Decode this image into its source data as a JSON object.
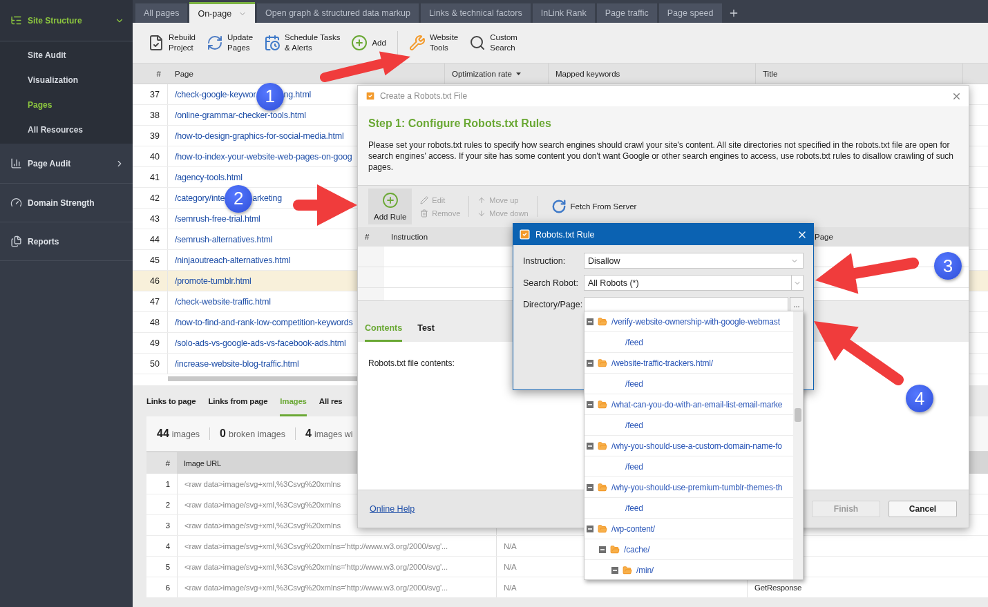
{
  "sidebar": {
    "items": [
      {
        "label": "Site Structure",
        "expanded": true,
        "selected": true,
        "children": [
          {
            "label": "Site Audit",
            "selected": false
          },
          {
            "label": "Visualization",
            "selected": false
          },
          {
            "label": "Pages",
            "selected": true
          },
          {
            "label": "All Resources",
            "selected": false
          }
        ]
      },
      {
        "label": "Page Audit",
        "expanded": false,
        "selected": false
      },
      {
        "label": "Domain Strength",
        "selected": false
      },
      {
        "label": "Reports",
        "selected": false
      }
    ]
  },
  "tabs": [
    {
      "label": "All pages",
      "selected": false,
      "menu": false
    },
    {
      "label": "On-page",
      "selected": true,
      "menu": true
    },
    {
      "label": "Open graph & structured data markup",
      "selected": false,
      "menu": false
    },
    {
      "label": "Links & technical factors",
      "selected": false,
      "menu": false
    },
    {
      "label": "InLink Rank",
      "selected": false,
      "menu": false
    },
    {
      "label": "Page traffic",
      "selected": false,
      "menu": false
    },
    {
      "label": "Page speed",
      "selected": false,
      "menu": false
    }
  ],
  "toolbar": [
    {
      "lines": [
        "Rebuild",
        "Project"
      ],
      "separator_before": false
    },
    {
      "lines": [
        "Update",
        "Pages"
      ],
      "separator_before": false
    },
    {
      "lines": [
        "Schedule Tasks",
        "& Alerts"
      ],
      "separator_before": false
    },
    {
      "lines": [
        "Add"
      ],
      "separator_before": false
    },
    {
      "lines": [
        "Website",
        "Tools"
      ],
      "separator_before": true
    },
    {
      "lines": [
        "Custom",
        "Search"
      ],
      "separator_before": false
    }
  ],
  "table": {
    "columns": [
      {
        "label": "#",
        "menu": false
      },
      {
        "label": "Page",
        "menu": false
      },
      {
        "label": "Optimization rate",
        "menu": true
      },
      {
        "label": "Mapped keywords",
        "menu": false
      },
      {
        "label": "Title",
        "menu": false
      }
    ],
    "rows": [
      {
        "number": "37",
        "page_parts": [
          "/check-google-keywor",
          "ng.html"
        ],
        "callout": "1",
        "selected": false
      },
      {
        "number": "38",
        "page_parts": [
          "/online-grammar-checker-tools.html"
        ],
        "selected": false
      },
      {
        "number": "39",
        "page_parts": [
          "/how-to-design-graphics-for-social-media.html"
        ],
        "selected": false
      },
      {
        "number": "40",
        "page_parts": [
          "/how-to-index-your-website-web-pages-on-goog"
        ],
        "selected": false
      },
      {
        "number": "41",
        "page_parts": [
          "/agency-tools.html"
        ],
        "selected": false
      },
      {
        "number": "42",
        "page_parts": [
          "/category/inte",
          "arketing"
        ],
        "callout": "2",
        "selected": false
      },
      {
        "number": "43",
        "page_parts": [
          "/semrush-free-trial.html"
        ],
        "selected": false
      },
      {
        "number": "44",
        "page_parts": [
          "/semrush-alternatives.html"
        ],
        "selected": false
      },
      {
        "number": "45",
        "page_parts": [
          "/ninjaoutreach-alternatives.html"
        ],
        "selected": false
      },
      {
        "number": "46",
        "page_parts": [
          "/promote-tumblr.html"
        ],
        "selected": true
      },
      {
        "number": "47",
        "page_parts": [
          "/check-website-traffic.html"
        ],
        "selected": false
      },
      {
        "number": "48",
        "page_parts": [
          "/how-to-find-and-rank-low-competition-keywords"
        ],
        "selected": false
      },
      {
        "number": "49",
        "page_parts": [
          "/solo-ads-vs-google-ads-vs-facebook-ads.html"
        ],
        "selected": false
      },
      {
        "number": "50",
        "page_parts": [
          "/increase-website-blog-traffic.html"
        ],
        "selected": false
      }
    ]
  },
  "bottom": {
    "tabs": [
      {
        "label": "Links to page",
        "selected": false
      },
      {
        "label": "Links from page",
        "selected": false
      },
      {
        "label": "Images",
        "selected": true
      },
      {
        "label": "All res",
        "selected": false
      }
    ],
    "stats": [
      {
        "count": "44",
        "label": "images"
      },
      {
        "count": "0",
        "label": "broken images"
      },
      {
        "count": "4",
        "label": "images wi"
      }
    ],
    "image_table": {
      "columns": [
        "#",
        "Image URL"
      ],
      "rows": [
        {
          "number": "1",
          "url": "<raw data>image/svg+xml,%3Csvg%20xmlns"
        },
        {
          "number": "2",
          "url": "<raw data>image/svg+xml,%3Csvg%20xmlns"
        },
        {
          "number": "3",
          "url": "<raw data>image/svg+xml,%3Csvg%20xmlns"
        },
        {
          "number": "4",
          "url": "<raw data>image/svg+xml,%3Csvg%20xmlns='http://www.w3.org/2000/svg'...",
          "column_3": "N/A"
        },
        {
          "number": "5",
          "url": "<raw data>image/svg+xml,%3Csvg%20xmlns='http://www.w3.org/2000/svg'...",
          "column_3": "N/A"
        },
        {
          "number": "6",
          "url": "<raw data>image/svg+xml,%3Csvg%20xmlns='http://www.w3.org/2000/svg'...",
          "column_3": "N/A",
          "column_4": "GetResponse"
        }
      ]
    }
  },
  "robots_dialog": {
    "title": "Create a Robots.txt File",
    "heading": "Step 1: Configure Robots.txt Rules",
    "description": "Please set your robots.txt rules to specify how search engines should crawl your site's content. All site directories not specified in the robots.txt file are open for search engines' access. If your site has some content you don't want Google or other search engines to access, use robots.txt rules to disallow crawling of such pages.",
    "toolbar": [
      {
        "label": "Add Rule",
        "kind": "large",
        "disabled": false,
        "highlighted": true
      },
      {
        "label": "Edit",
        "kind": "small",
        "disabled": true,
        "highlighted": false
      },
      {
        "label": "Remove",
        "kind": "small",
        "disabled": true,
        "highlighted": false
      },
      {
        "label": "Move up",
        "kind": "small",
        "disabled": true,
        "highlighted": false
      },
      {
        "label": "Move down",
        "kind": "small",
        "disabled": true,
        "highlighted": false
      },
      {
        "label": "Fetch From Server",
        "kind": "large",
        "disabled": false,
        "highlighted": false
      }
    ],
    "rule_columns": [
      "#",
      "Instruction",
      "Page"
    ],
    "tabs": [
      {
        "label": "Contents",
        "selected": true
      },
      {
        "label": "Test",
        "selected": false
      }
    ],
    "contents_label": "Robots.txt file contents:",
    "help_link": "Online Help",
    "buttons": [
      {
        "label": "Finish",
        "disabled": true
      },
      {
        "label": "Cancel",
        "disabled": false
      }
    ]
  },
  "rule_dialog": {
    "title": "Robots.txt Rule",
    "fields": [
      {
        "label": "Instruction:",
        "kind": "select",
        "value": "Disallow"
      },
      {
        "label": "Search Robot:",
        "kind": "combo",
        "value": "All Robots (*)"
      },
      {
        "label": "Directory/Page:",
        "kind": "browse",
        "browse_label": "..."
      }
    ],
    "tree": [
      {
        "label": "/verify-website-ownership-with-google-webmast",
        "expanded": true,
        "children": [
          {
            "label": "/feed"
          }
        ]
      },
      {
        "label": "/website-traffic-trackers.html/",
        "expanded": true,
        "children": [
          {
            "label": "/feed"
          }
        ]
      },
      {
        "label": "/what-can-you-do-with-an-email-list-email-marke",
        "expanded": true,
        "children": [
          {
            "label": "/feed"
          }
        ]
      },
      {
        "label": "/why-you-should-use-a-custom-domain-name-fo",
        "expanded": true,
        "children": [
          {
            "label": "/feed"
          }
        ]
      },
      {
        "label": "/why-you-should-use-premium-tumblr-themes-th",
        "expanded": true,
        "children": [
          {
            "label": "/feed"
          }
        ]
      },
      {
        "label": "/wp-content/",
        "expanded": true,
        "children": [
          {
            "label": "/cache/",
            "expanded": true,
            "children": [
              {
                "label": "/min/",
                "expanded": true
              }
            ]
          }
        ]
      }
    ]
  },
  "callouts": [
    {
      "number": "3"
    },
    {
      "number": "4"
    }
  ]
}
